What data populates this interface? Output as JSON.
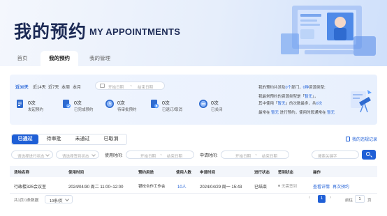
{
  "header": {
    "title_cn": "我的预约",
    "title_en": "MY APPOINTMENTS"
  },
  "nav": {
    "tabs": [
      "首页",
      "我的预约",
      "我的管理"
    ],
    "active": 1
  },
  "summary": {
    "periods": [
      "近30天",
      "近14天",
      "近7天",
      "本周",
      "本月"
    ],
    "active_period": 0,
    "date_start_placeholder": "开始日期",
    "date_sep": "~",
    "date_end_placeholder": "结束日期",
    "stats": [
      {
        "value": "0次",
        "label": "发起预约"
      },
      {
        "value": "0次",
        "label": "已完成预约"
      },
      {
        "value": "0次",
        "label": "待审批预约"
      },
      {
        "value": "0次",
        "label": "已退订/取消"
      },
      {
        "value": "0次",
        "label": "已关闭"
      }
    ],
    "text": {
      "l1_a": "我的预约共涉及",
      "l1_b": "0个",
      "l1_c": "部门，",
      "l1_d": "0种",
      "l1_e": "资源类型;",
      "l2_a": "我最常预约的资源类型是「",
      "l2_b": "暂无",
      "l2_c": "」，",
      "l3_a": "其中使用「",
      "l3_b": "暂无",
      "l3_c": "」的次数最多，共",
      "l3_d": "0次",
      "l4_a": "最常在",
      "l4_b": "暂无",
      "l4_c": "进行预约，使用时段通常在",
      "l4_d": "暂无"
    }
  },
  "status_tabs": [
    "已通过",
    "待审批",
    "未通过",
    "已取消"
  ],
  "active_status": 0,
  "violation_link": "我的违规记录",
  "filters": {
    "status_placeholder": "请选择进行状态",
    "type_placeholder": "请选择签到状态",
    "use_time_label": "使用时间:",
    "apply_time_label": "申请时间:",
    "date_start_placeholder": "开始日期",
    "date_sep": "~",
    "date_end_placeholder": "结束日期",
    "keyword_placeholder": "搜索关键字"
  },
  "table": {
    "columns": [
      "场地名称",
      "使用时间",
      "预约用途",
      "使用人数",
      "申请时间",
      "进行状态",
      "签到状态",
      "操作"
    ],
    "rows": [
      {
        "venue": "行政楼325会议室",
        "use_time": "2024/04/30 周二 11:00~12:00",
        "purpose": "银校合作工作会",
        "people": "10人",
        "apply_time": "2024/04/29 周一 15:43",
        "status": "已结束",
        "checkin": "无需签到",
        "action_view": "查看详情",
        "action_again": "再次预约"
      }
    ]
  },
  "pager": {
    "total": "共1页/1条数据",
    "page_size": "10条/页",
    "prev": "‹",
    "current": "1",
    "next": "›",
    "goto_label": "前往",
    "goto_value": "1",
    "page_unit": "页"
  }
}
